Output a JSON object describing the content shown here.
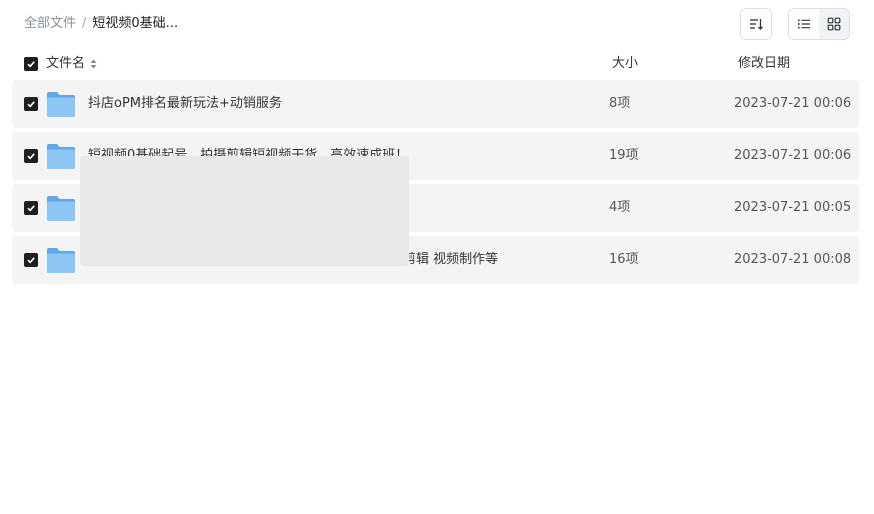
{
  "breadcrumb": {
    "root": "全部文件",
    "separator": "/",
    "current": "短视频0基础..."
  },
  "toolbar": {
    "sort_icon": "sort-icon",
    "list_view_icon": "list-view-icon",
    "grid_view_icon": "grid-view-icon",
    "active_view": "list"
  },
  "columns": {
    "name": "文件名",
    "size": "大小",
    "date": "修改日期"
  },
  "rows": [
    {
      "name": "抖店oPM排名最新玩法+动销服务",
      "size": "8项",
      "date": "2023-07-21 00:06",
      "checked": true
    },
    {
      "name": "短视频0基础起号，拍摄剪辑短视频干货，高效速成班！",
      "size": "19项",
      "date": "2023-07-21 00:06",
      "checked": true
    },
    {
      "name": "",
      "size": "4项",
      "date": "2023-07-21 00:05",
      "checked": true
    },
    {
      "name": "素材剪辑 视频制作等",
      "size": "16项",
      "date": "2023-07-21 00:08",
      "checked": true
    }
  ],
  "colors": {
    "row_bg": "#f4f4f4",
    "checkbox": "#1f1f1f",
    "folder": "#6cb3ef"
  }
}
